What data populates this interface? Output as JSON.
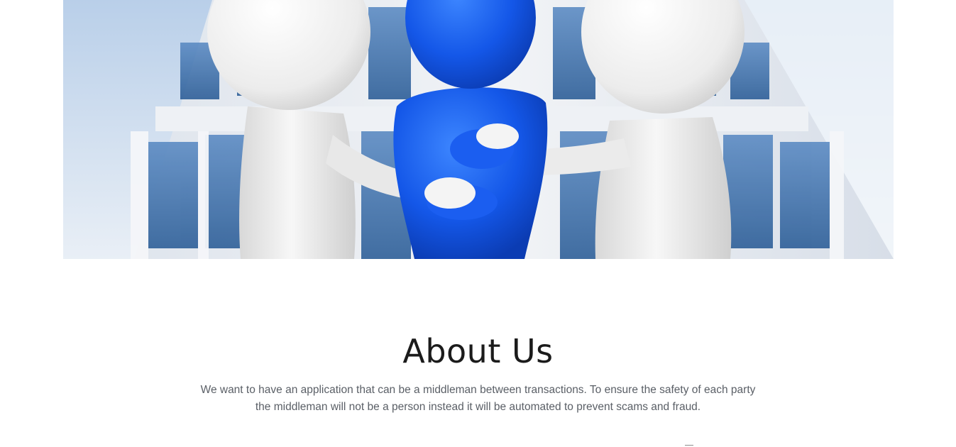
{
  "hero": {
    "image_description_icon": "handshake-figures-illustration",
    "colors": {
      "sky": "#c7d9ee",
      "building": "#e6eaf0",
      "windows": "#3f6fa6",
      "blue_figure": "#1457e8",
      "white_figure": "#f2f2f2"
    }
  },
  "about": {
    "title": "About Us",
    "line1": "We want to have an application that can be a middleman between transactions. To ensure the safety of each party",
    "line2": "the middleman will not be a person instead it will be automated to prevent scams and fraud."
  }
}
